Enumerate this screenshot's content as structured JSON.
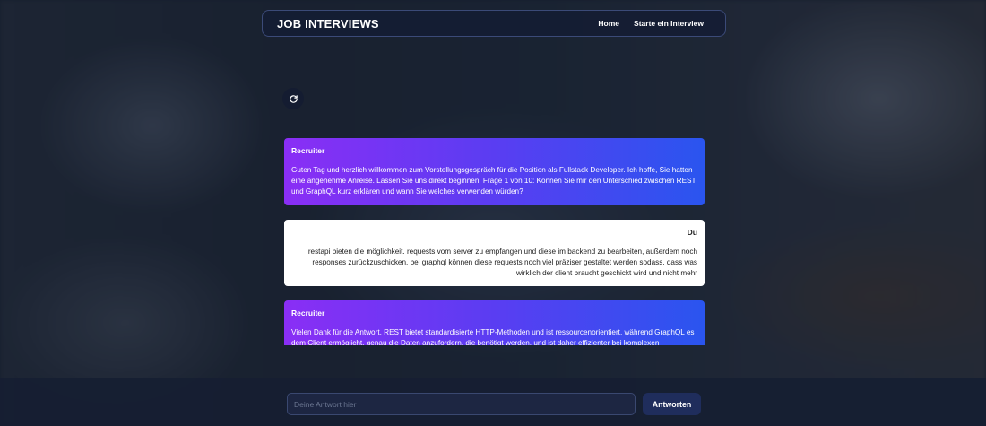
{
  "navbar": {
    "brand": "JOB INTERVIEWS",
    "links": [
      {
        "label": "Home"
      },
      {
        "label": "Starte ein Interview"
      }
    ]
  },
  "icons": {
    "reset": "refresh-icon"
  },
  "chat": {
    "messages": [
      {
        "author": "Recruiter",
        "role": "recruiter",
        "text": "Guten Tag und herzlich willkommen zum Vorstellungsgespräch für die Position als Fullstack Developer. Ich hoffe, Sie hatten eine angenehme Anreise. Lassen Sie uns direkt beginnen. Frage 1 von 10: Können Sie mir den Unterschied zwischen REST und GraphQL kurz erklären und wann Sie welches verwenden würden?"
      },
      {
        "author": "Du",
        "role": "user",
        "text": "restapi bieten die möglichkeit. requests vom server zu empfangen und diese im backend zu bearbeiten, außerdem noch responses zurückzuschicken. bei graphql können diese requests noch viel präziser gestaltet werden sodass, dass was wirklich der client braucht geschickt wird und nicht mehr"
      },
      {
        "author": "Recruiter",
        "role": "recruiter",
        "text": "Vielen Dank für die Antwort. REST bietet standardisierte HTTP-Methoden und ist ressourcenorientiert, während GraphQL es dem Client ermöglicht, genau die Daten anzufordern, die benötigt werden, und ist daher effizienter bei komplexen"
      }
    ]
  },
  "composer": {
    "placeholder": "Deine Antwort hier",
    "value": "",
    "submit_label": "Antworten"
  },
  "colors": {
    "recruiter_gradient_start": "#8a2ef5",
    "recruiter_gradient_end": "#2a55ef",
    "user_bubble": "#ffffff",
    "button_bg": "#1f2d5c"
  }
}
